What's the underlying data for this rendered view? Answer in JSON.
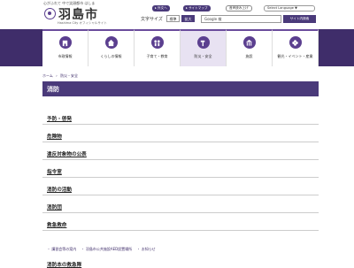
{
  "header": {
    "tagline": "心がふれて 中で笑顔都市 はしま",
    "city_name": "羽島市",
    "city_en": "Hashima City  オフィシャルサイト",
    "top_buttons": {
      "english": "▸ 外文へ",
      "sitemap": "▸ サイトマップ",
      "voice": "音声読み上げ",
      "language": "Select Language ▼"
    },
    "font_size_label": "文字サイズ",
    "font_std": "標準",
    "font_big": "拡大",
    "search_value": "Google 検",
    "search_button": "サイト内検索"
  },
  "nav": [
    {
      "label": "市政情報",
      "icon": "building-icon"
    },
    {
      "label": "くらしの情報",
      "icon": "house-icon"
    },
    {
      "label": "子育て・教育",
      "icon": "family-icon"
    },
    {
      "label": "防災・安全",
      "icon": "hammer-icon",
      "active": true
    },
    {
      "label": "施設",
      "icon": "facility-icon"
    },
    {
      "label": "観光・イベント・産業",
      "icon": "flower-icon"
    }
  ],
  "breadcrumb": [
    "ホーム",
    "›",
    "防災・安全"
  ],
  "page_title": "消防",
  "links": [
    "予防・啓発",
    "危険物",
    "違反対象物の公表",
    "指令室",
    "消防の活動",
    "消防団",
    "救急救命"
  ],
  "footer_links": [
    "・ 講習会等の案内",
    "・ 羽島市公共施設AED設置場所",
    "・ お知らせ"
  ],
  "next_section": "消防本の救急隊"
}
